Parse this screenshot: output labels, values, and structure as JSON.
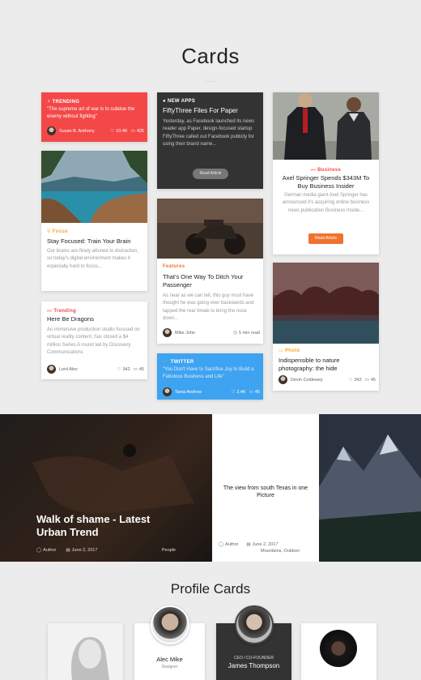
{
  "page_title": "Cards",
  "trending": {
    "category": "TRENDING",
    "quote": "\"The supreme art of war is to subdue the enemy without fighting\"",
    "author": "Susan B. Anthony",
    "likes": "10.4K",
    "comments": "425"
  },
  "focus": {
    "category": "Focus",
    "title": "Stay Focused: Train Your Brain",
    "body": "Our brains are finely attuned to distraction, so today's digital environment makes it especially hard to focus..."
  },
  "dragons": {
    "category": "Trending",
    "title": "Here Be Dragons",
    "body": "An immersive production studio focused on virtual reality content, has closed a $4 million Series A round led by Discovery Communications",
    "author": "Lord Alex",
    "likes": "342",
    "comments": "45"
  },
  "newapps": {
    "category": "NEW APPS",
    "title": "FiftyThree Files For Paper",
    "body": "Yesterday, as Facebook launched its news reader app Paper, design-focused startup FiftyThree called out Facebook publicly for using their brand name...",
    "button": "Read Article"
  },
  "features": {
    "category": "Features",
    "title": "That's One Way To Ditch Your Passenger",
    "body": "As near as we can tell, this guy must have thought he was going over backwards and tapped the rear break to bring the nose down...",
    "author": "Mike John",
    "read_time": "5 min read"
  },
  "twitter": {
    "category": "TWITTER",
    "quote": "\"You Don't Have to Sacrifice Joy to Build a Fabulous Business and Life\"",
    "author": "Tania Andrew",
    "likes": "2.4K",
    "comments": "45"
  },
  "business": {
    "category": "Business",
    "title": "Axel Springer Spends $343M To Buy Business Insider",
    "body": "German media giant Axel Springer has announced it's acquiring online business news publication Business Inside...",
    "button": "Read Article"
  },
  "photo": {
    "category": "Photo",
    "title": "Indispensible to nature photography: the hide",
    "author": "Devin Coldewey",
    "likes": "342",
    "comments": "45"
  },
  "banner_left": {
    "title": "Walk of shame - Latest Urban Trend",
    "author": "Author",
    "date": "June 2, 2017",
    "tag": "People"
  },
  "banner_mid": {
    "title": "The view from south Texas in one Picture",
    "author": "Author",
    "date": "June 2, 2017",
    "tags": "Mountains, Outdoor"
  },
  "profiles_title": "Profile Cards",
  "profiles": [
    {
      "name": "Alec Mike",
      "role": "Designer"
    },
    {
      "name": "James Thompson",
      "role": "CEO / CO-FOUNDER"
    }
  ],
  "colors": {
    "red": "#f44848",
    "blue": "#3ea3f0",
    "orange": "#f0722f",
    "dark": "#333333",
    "gold": "#f5a623"
  }
}
